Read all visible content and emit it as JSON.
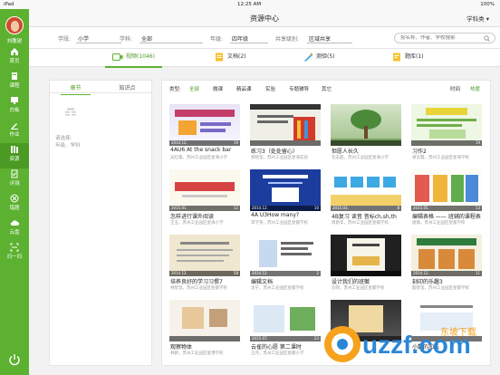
{
  "status": {
    "carrier": "iPad",
    "time": "12:25 AM",
    "battery": "100%"
  },
  "header": {
    "title": "资源中心",
    "category": "学科类 ▾"
  },
  "user": {
    "name": "刘敬锐"
  },
  "sidebar": {
    "items": [
      {
        "label": "首页",
        "icon": "home-icon"
      },
      {
        "label": "课程",
        "icon": "book-icon"
      },
      {
        "label": "白板",
        "icon": "whiteboard-icon"
      },
      {
        "label": "作业",
        "icon": "homework-icon"
      },
      {
        "label": "资源",
        "icon": "resource-icon",
        "active": true
      },
      {
        "label": "评测",
        "icon": "test-icon"
      },
      {
        "label": "错题",
        "icon": "mistake-icon"
      },
      {
        "label": "云盘",
        "icon": "cloud-icon"
      },
      {
        "label": "扫一扫",
        "icon": "scan-icon"
      }
    ]
  },
  "filters": {
    "stage_label": "学段:",
    "stage": "小学",
    "subject_label": "学科:",
    "subject": "全部",
    "grade_label": "年级:",
    "grade": "四年级",
    "share_label": "共享级别:",
    "share": "区域共享",
    "search_placeholder": "按名称、作者、学校搜索"
  },
  "type_tabs": [
    {
      "label": "视频(1046)",
      "icon": "video-icon",
      "active": true
    },
    {
      "label": "文档(2)",
      "icon": "document-icon"
    },
    {
      "label": "测验(5)",
      "icon": "quiz-icon"
    },
    {
      "label": "题库(1)",
      "icon": "question-bank-icon"
    }
  ],
  "left_panel": {
    "tab_chapter": "章节",
    "tab_knowledge": "知识点",
    "hint_line1": "请选择:",
    "hint_line2": "年级、学科"
  },
  "sortbar": {
    "type_label": "类型:",
    "types": [
      "全部",
      "微课",
      "精品课",
      "实验",
      "专题辅导",
      "其它"
    ],
    "sort_time": "时间",
    "sort_hot": "热度"
  },
  "cards": [
    {
      "title": "4AU6 At the snack bar",
      "sub": "吴红霞，苏州工业园区星海小学",
      "date": "2014.12.",
      "views": "19"
    },
    {
      "title": "练习3（处处留心）",
      "sub": "郭晓莹，苏州工业园区星海实验",
      "date": "",
      "views": ""
    },
    {
      "title": "但愿人长久",
      "sub": "包志超，苏州工业园区星海小学",
      "date": "",
      "views": ""
    },
    {
      "title": "习作2",
      "sub": "谢云霞，苏州工业园区星海学校",
      "date": "",
      "views": "19"
    },
    {
      "title": "怎样进行课外阅读",
      "sub": "王玉，苏州工业园区星海小学",
      "date": "2015.01.",
      "views": "12"
    },
    {
      "title": "4A U3How many?",
      "sub": "李学英，苏州工业园区星都学校",
      "date": "2014.12.",
      "views": "10"
    },
    {
      "title": "4B复习 读音 音标ch,sh,th",
      "sub": "周艳华，苏州工业园区星都学校",
      "date": "2015.03.",
      "views": "8"
    },
    {
      "title": "编辑表格 —— 班辅的课程表",
      "sub": "唐薇，苏州工业园区星都学校",
      "date": "2015.05.",
      "views": "13"
    },
    {
      "title": "培养良好的学习习惯7",
      "sub": "林智莹，苏州工业园区星都学校",
      "date": "2014.12.",
      "views": "58"
    },
    {
      "title": "编辑文档",
      "sub": "沈宁，苏州工业园区星都学校",
      "date": "2014.12.",
      "views": "2"
    },
    {
      "title": "设计我们的班徽",
      "sub": "刘玥，苏州工业园区星都学校",
      "date": "",
      "views": ""
    },
    {
      "title": "刻印的乐趣3",
      "sub": "殷智莹，苏州工业园区星都学校",
      "date": "2014.12.",
      "views": "11"
    },
    {
      "title": "观察物体",
      "sub": "林艳，苏州工业园区星港学校",
      "date": "",
      "views": ""
    },
    {
      "title": "云雀的心愿 第二课时",
      "sub": "王月，苏州工业园区星都小学",
      "date": "2015.07.",
      "views": "23"
    },
    {
      "title": "但愿人长久",
      "sub": "",
      "date": "",
      "views": ""
    },
    {
      "title": "小数的加法",
      "sub": "",
      "date": "",
      "views": ""
    }
  ],
  "watermark": {
    "brand": "uzzf.com",
    "brand_cn": "东坡下载"
  }
}
